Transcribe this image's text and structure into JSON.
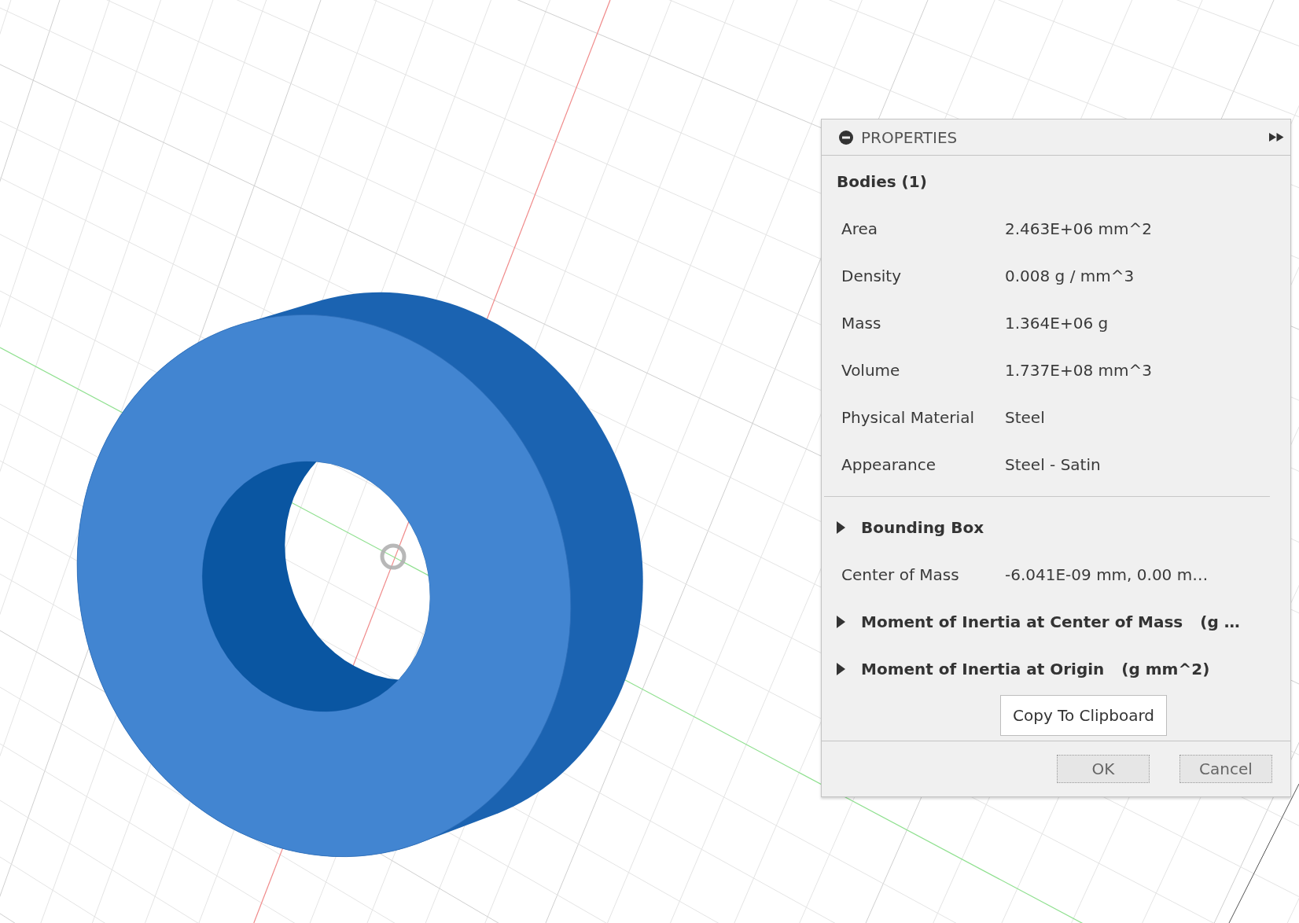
{
  "panel": {
    "title": "PROPERTIES",
    "section": "Bodies (1)",
    "properties": [
      {
        "label": "Area",
        "value": "2.463E+06 mm^2"
      },
      {
        "label": "Density",
        "value": "0.008 g / mm^3"
      },
      {
        "label": "Mass",
        "value": "1.364E+06 g"
      },
      {
        "label": "Volume",
        "value": "1.737E+08 mm^3"
      },
      {
        "label": "Physical Material",
        "value": "Steel"
      },
      {
        "label": "Appearance",
        "value": "Steel - Satin"
      }
    ],
    "details": [
      {
        "kind": "expander",
        "label": "Bounding Box",
        "expanded": false
      },
      {
        "kind": "property",
        "label": "Center of Mass",
        "value": "-6.041E-09 mm, 0.00 m…"
      },
      {
        "kind": "expander",
        "label": "Moment of Inertia at Center of Mass",
        "unit": "(g …",
        "expanded": false
      },
      {
        "kind": "expander",
        "label": "Moment of Inertia at Origin",
        "unit": "(g mm^2)",
        "expanded": false
      }
    ],
    "copy_button": "Copy To Clipboard",
    "buttons": [
      "OK",
      "Cancel"
    ]
  }
}
